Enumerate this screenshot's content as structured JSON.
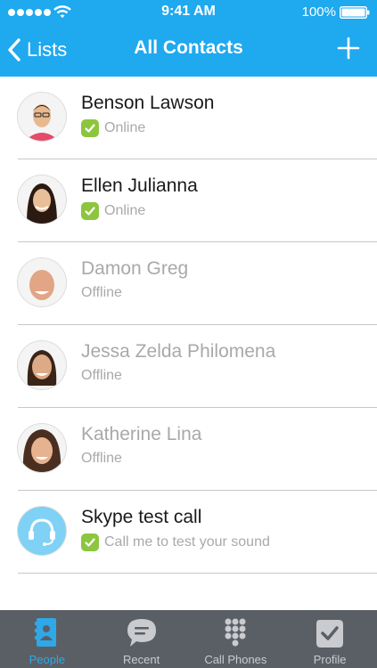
{
  "status_bar": {
    "time": "9:41 AM",
    "battery": "100%"
  },
  "nav": {
    "back_label": "Lists",
    "title": "All Contacts",
    "add_icon": "plus-icon"
  },
  "contacts": [
    {
      "name": "Benson Lawson",
      "status": "Online",
      "presence": "online"
    },
    {
      "name": "Ellen Julianna",
      "status": "Online",
      "presence": "online"
    },
    {
      "name": "Damon Greg",
      "status": "Offline",
      "presence": "offline"
    },
    {
      "name": "Jessa Zelda Philomena",
      "status": "Offline",
      "presence": "offline"
    },
    {
      "name": "Katherine Lina",
      "status": "Offline",
      "presence": "offline"
    },
    {
      "name": "Skype test call",
      "status": "Call me to test your sound",
      "presence": "online"
    }
  ],
  "tabs": [
    {
      "label": "People",
      "icon": "people-icon",
      "active": true
    },
    {
      "label": "Recent",
      "icon": "chat-bubble-icon",
      "active": false
    },
    {
      "label": "Call Phones",
      "icon": "dialpad-icon",
      "active": false
    },
    {
      "label": "Profile",
      "icon": "profile-icon",
      "active": false
    }
  ],
  "colors": {
    "header": "#1fa9ef",
    "online_badge": "#8cc63f",
    "tab_bar": "#5a5f66",
    "tab_active": "#2ea8e8",
    "offline_text": "#a9a9a9"
  }
}
